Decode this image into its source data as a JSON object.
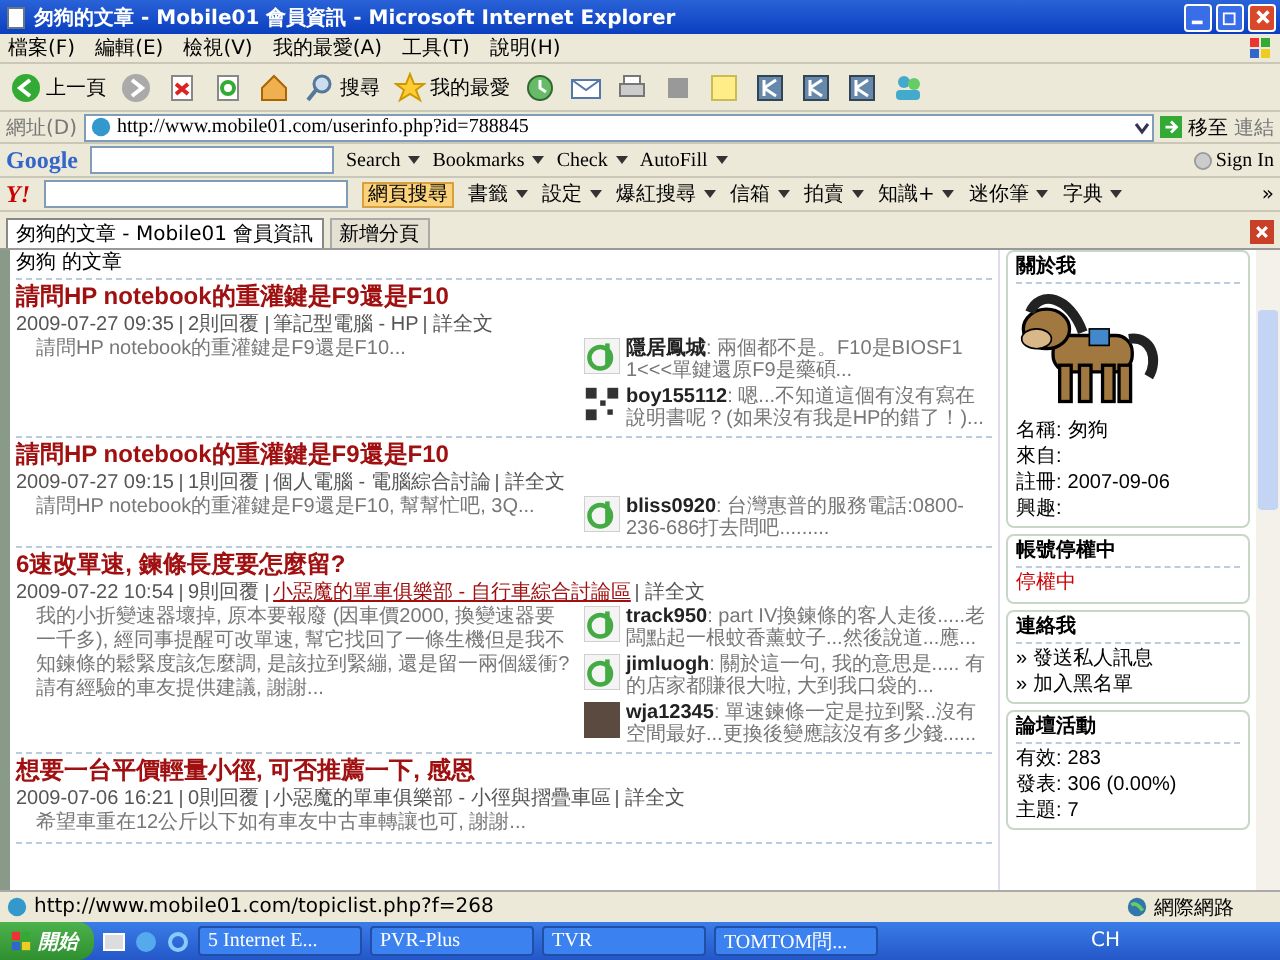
{
  "window": {
    "title": "匆狗的文章 - Mobile01 會員資訊 - Microsoft Internet Explorer"
  },
  "menu": [
    "檔案(F)",
    "編輯(E)",
    "檢視(V)",
    "我的最愛(A)",
    "工具(T)",
    "說明(H)"
  ],
  "toolbar": [
    {
      "kind": "back",
      "label": "上一頁"
    },
    {
      "kind": "forward"
    },
    {
      "kind": "stop"
    },
    {
      "kind": "refresh"
    },
    {
      "kind": "home"
    },
    {
      "kind": "search",
      "label": "搜尋"
    },
    {
      "kind": "star",
      "label": "我的最愛"
    },
    {
      "kind": "clock"
    },
    {
      "kind": "mail"
    },
    {
      "kind": "printer"
    },
    {
      "kind": "square"
    },
    {
      "kind": "note"
    },
    {
      "kind": "app"
    },
    {
      "kind": "app"
    },
    {
      "kind": "app"
    },
    {
      "kind": "people"
    }
  ],
  "address": {
    "label": "網址(D)",
    "url": "http://www.mobile01.com/userinfo.php?id=788845",
    "go": "移至",
    "links": "連結"
  },
  "google_toolbar": {
    "logo": "Google",
    "items": [
      "Search",
      "Bookmarks",
      "Check",
      "AutoFill"
    ],
    "sign_in": "Sign In"
  },
  "yahoo_toolbar": {
    "logo": "Y!",
    "search_button": "網頁搜尋",
    "items": [
      "書籤",
      "設定",
      "爆紅搜尋",
      "信箱",
      "拍賣",
      "知識+",
      "迷你筆",
      "字典"
    ],
    "more": "»"
  },
  "tabs": [
    {
      "label": "匆狗的文章 - Mobile01 會員資訊",
      "selected": true
    },
    {
      "label": "新增分頁",
      "selected": false
    }
  ],
  "page": {
    "heading": "匆狗 的文章",
    "articles": [
      {
        "title": "請問HP notebook的重灌鍵是F9還是F10",
        "date": "2009-07-27 09:35",
        "replies": "2則回覆",
        "category": "筆記型電腦 - HP",
        "category_underlined": false,
        "more": "詳全文",
        "excerpt": "請問HP notebook的重灌鍵是F9還是F10...",
        "comments": [
          {
            "kind": "smiley",
            "text": "**隱居鳳城**: 兩個都不是。F10是BIOSF1 1<<<單鍵還原F9是藥碩..."
          },
          {
            "kind": "pattern",
            "text": "**boy155112**: 嗯...不知道這個有沒有寫在說明書呢？(如果沒有我是HP的錯了！)..."
          }
        ]
      },
      {
        "title": "請問HP notebook的重灌鍵是F9還是F10",
        "date": "2009-07-27 09:15",
        "replies": "1則回覆",
        "category": "個人電腦 - 電腦綜合討論",
        "category_underlined": false,
        "more": "詳全文",
        "excerpt": "請問HP notebook的重灌鍵是F9還是F10, 幫幫忙吧, 3Q...",
        "comments": [
          {
            "kind": "smiley",
            "text": "**bliss0920**: 台灣惠普的服務電話:0800-236-686打去問吧........."
          }
        ]
      },
      {
        "title": "6速改單速, 鍊條長度要怎麼留?",
        "date": "2009-07-22 10:54",
        "replies": "9則回覆",
        "category": "小惡魔的單車俱樂部 - 自行車綜合討論區",
        "category_underlined": true,
        "more": "詳全文",
        "excerpt": "我的小折變速器壞掉, 原本要報廢 (因車價2000, 換變速器要一千多), 經同事提醒可改單速, 幫它找回了一條生機但是我不知鍊條的鬆緊度該怎麼調, 是該拉到緊繃, 還是留一兩個緩衝?請有經驗的車友提供建議, 謝謝...",
        "comments": [
          {
            "kind": "smiley",
            "text": "**track950**: part IV換鍊條的客人走後.....老闆點起一根蚊香薰蚊子...然後說道...應..."
          },
          {
            "kind": "smiley",
            "text": "**jimluogh**: 關於這一句, 我的意思是..... 有的店家都賺很大啦, 大到我口袋的..."
          },
          {
            "kind": "photo",
            "text": "**wja12345**: 單速鍊條一定是拉到緊..沒有空間最好...更換後變應該沒有多少錢......"
          }
        ]
      },
      {
        "title": "想要一台平價輕量小徑, 可否推薦一下, 感恩",
        "date": "2009-07-06 16:21",
        "replies": "0則回覆",
        "category": "小惡魔的單車俱樂部 - 小徑與摺疊車區",
        "category_underlined": false,
        "more": "詳全文",
        "excerpt": "希望車重在12公斤以下如有車友中古車轉讓也可, 謝謝..."
      }
    ]
  },
  "sidebar": {
    "about": {
      "title": "關於我",
      "fields": [
        {
          "label": "名稱:",
          "value": "匆狗"
        },
        {
          "label": "來自:"
        },
        {
          "label": "註冊:",
          "value": "2007-09-06"
        },
        {
          "label": "興趣:"
        }
      ]
    },
    "suspended": {
      "title": "帳號停權中",
      "status": "停權中"
    },
    "contact": {
      "title": "連絡我",
      "links": [
        "» 發送私人訊息",
        "» 加入黑名單"
      ]
    },
    "activity": {
      "title": "論壇活動",
      "fields": [
        {
          "label": "有效:",
          "value": "283"
        },
        {
          "label": "發表:",
          "value": "306 (0.00%)"
        },
        {
          "label": "主題:",
          "value": "7"
        }
      ]
    }
  },
  "status_bar": {
    "text": "http://www.mobile01.com/topiclist.php?f=268",
    "zone": "網際網路"
  },
  "taskbar": {
    "start": "開始",
    "tasks": [
      "5 Internet E...",
      "PVR-Plus",
      "TVR",
      "TOMTOM問..."
    ],
    "tray": "CH"
  }
}
